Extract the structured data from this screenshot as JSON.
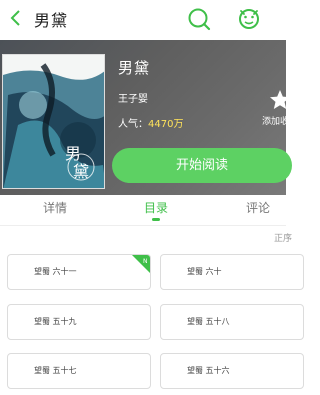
{
  "header": {
    "title": "男黛"
  },
  "book": {
    "name": "男黛",
    "author": "王子婴",
    "popularity_label": "人气：",
    "popularity_value": "4470万",
    "add_label": "添加收藏",
    "cover_title_chars": [
      "男",
      "黛"
    ]
  },
  "actions": {
    "read_label": "开始阅读"
  },
  "tabs": [
    {
      "label": "详情"
    },
    {
      "label": "目录"
    },
    {
      "label": "评论"
    }
  ],
  "sort_label": "正序",
  "chapters": [
    {
      "label": "望蜀  六十一",
      "is_new": true
    },
    {
      "label": "望蜀  六十",
      "is_new": false
    },
    {
      "label": "望蜀  五十九",
      "is_new": false
    },
    {
      "label": "望蜀  五十八",
      "is_new": false
    },
    {
      "label": "望蜀  五十七",
      "is_new": false
    },
    {
      "label": "望蜀  五十六",
      "is_new": false
    }
  ],
  "new_badge_label": "N",
  "colors": {
    "accent": "#3fbf49",
    "button": "#5dd163",
    "popularity": "#ffe35a"
  }
}
